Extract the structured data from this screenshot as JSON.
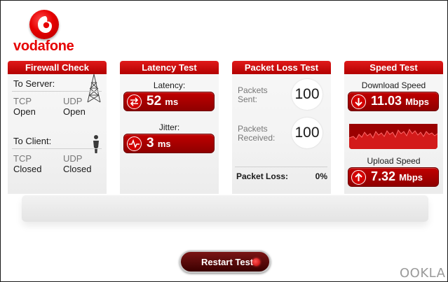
{
  "brand": {
    "name": "vodafone",
    "logo_color": "#e60000",
    "footer_logo": "OOKLA"
  },
  "firewall": {
    "title": "Firewall Check",
    "to_server": {
      "label": "To Server:",
      "tcp_label": "TCP",
      "tcp_value": "Open",
      "udp_label": "UDP",
      "udp_value": "Open"
    },
    "to_client": {
      "label": "To Client:",
      "tcp_label": "TCP",
      "tcp_value": "Closed",
      "udp_label": "UDP",
      "udp_value": "Closed"
    }
  },
  "latency": {
    "title": "Latency Test",
    "latency_label": "Latency:",
    "latency_value": "52",
    "latency_unit": "ms",
    "jitter_label": "Jitter:",
    "jitter_value": "3",
    "jitter_unit": "ms"
  },
  "packet_loss": {
    "title": "Packet Loss Test",
    "sent_label_1": "Packets",
    "sent_label_2": "Sent:",
    "sent_value": "100",
    "received_label_1": "Packets",
    "received_label_2": "Received:",
    "received_value": "100",
    "loss_label": "Packet Loss:",
    "loss_value": "0%"
  },
  "speed": {
    "title": "Speed Test",
    "download_label": "Download Speed",
    "download_value": "11.03",
    "download_unit": "Mbps",
    "upload_label": "Upload Speed",
    "upload_value": "7.32",
    "upload_unit": "Mbps"
  },
  "actions": {
    "restart_label": "Restart Test"
  }
}
